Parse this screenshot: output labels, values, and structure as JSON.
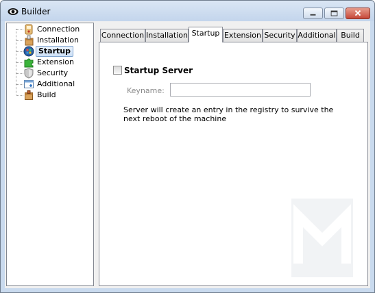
{
  "window": {
    "title": "Builder",
    "icon": "eye-icon"
  },
  "tree": {
    "items": [
      {
        "label": "Connection",
        "icon": "connection-icon"
      },
      {
        "label": "Installation",
        "icon": "installation-icon"
      },
      {
        "label": "Startup",
        "icon": "startup-icon",
        "selected": true
      },
      {
        "label": "Extension",
        "icon": "puzzle-icon"
      },
      {
        "label": "Security",
        "icon": "shield-icon"
      },
      {
        "label": "Additional",
        "icon": "additional-icon"
      },
      {
        "label": "Build",
        "icon": "build-icon"
      }
    ]
  },
  "tabs": [
    {
      "label": "Connection"
    },
    {
      "label": "Installation"
    },
    {
      "label": "Startup",
      "active": true
    },
    {
      "label": "Extension"
    },
    {
      "label": "Security"
    },
    {
      "label": "Additional"
    },
    {
      "label": "Build"
    }
  ],
  "startup": {
    "checkbox_label": "Startup Server",
    "checked": false,
    "keyname_label": "Keyname:",
    "keyname_value": "",
    "description": "Server will create an entry in the registry to survive the next reboot of the machine"
  }
}
